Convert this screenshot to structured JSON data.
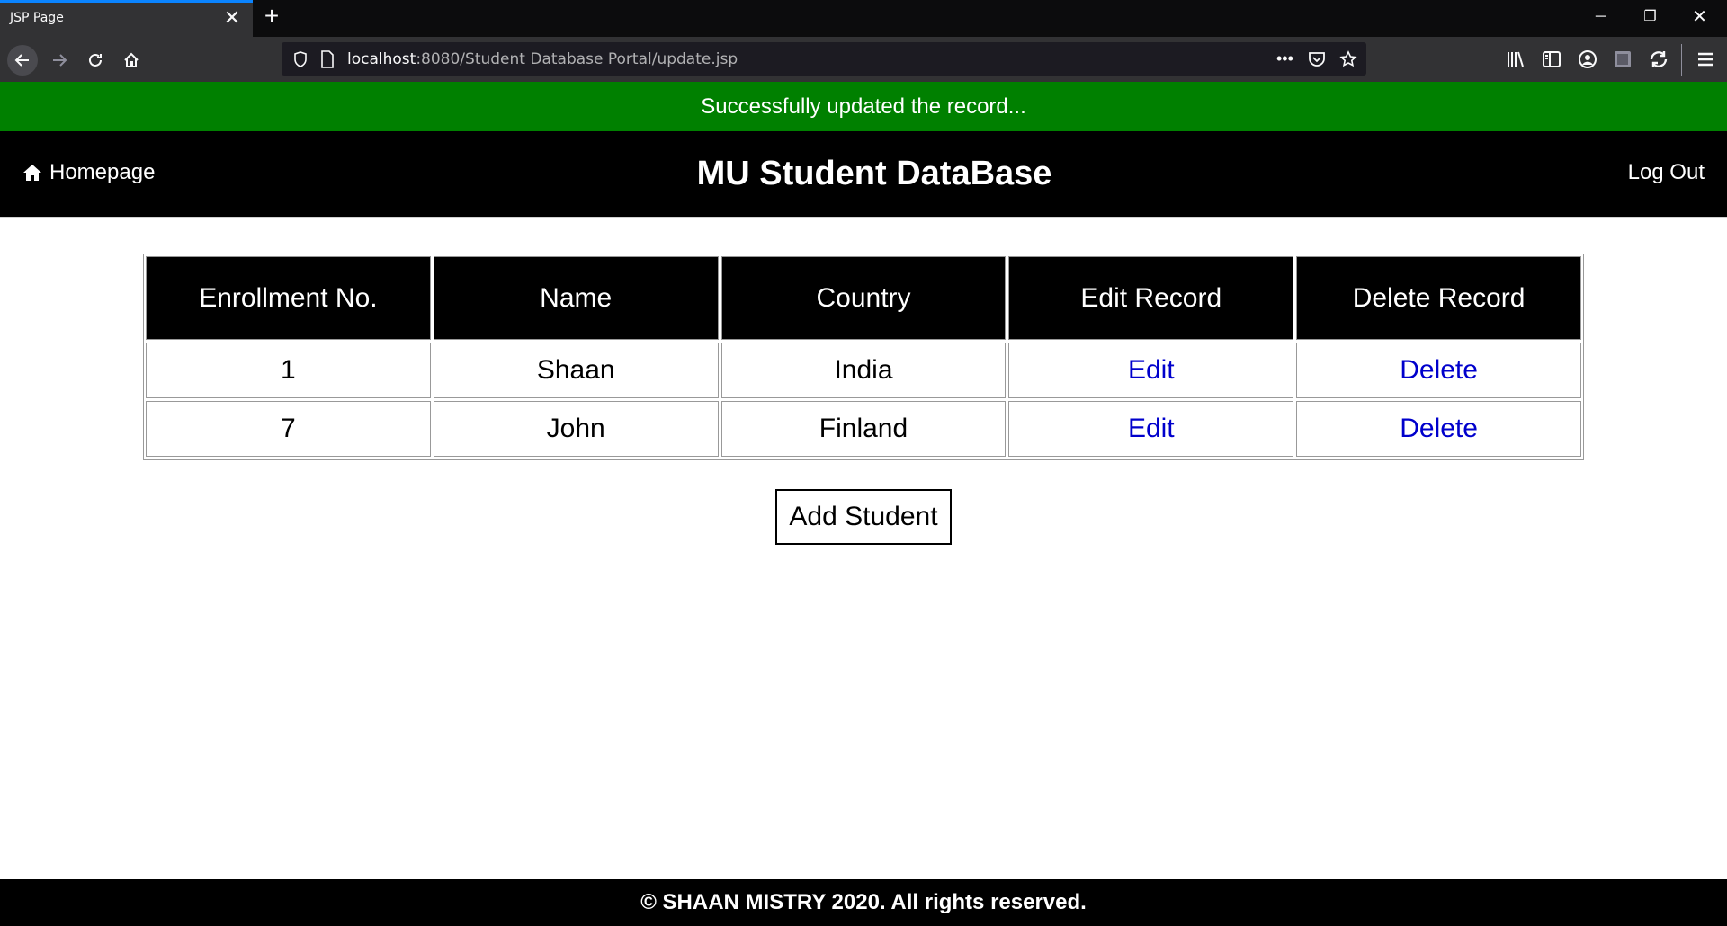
{
  "browser": {
    "tab_title": "JSP Page",
    "url_host": "localhost",
    "url_path": ":8080/Student Database Portal/update.jsp"
  },
  "flash": {
    "message": "Successfully updated the record...",
    "color": "#008000"
  },
  "header": {
    "home_label": "Homepage",
    "title": "MU Student DataBase",
    "logout_label": "Log Out"
  },
  "table": {
    "columns": [
      "Enrollment No.",
      "Name",
      "Country",
      "Edit Record",
      "Delete Record"
    ],
    "rows": [
      {
        "enrollment": "1",
        "name": "Shaan",
        "country": "India",
        "edit": "Edit",
        "delete": "Delete"
      },
      {
        "enrollment": "7",
        "name": "John",
        "country": "Finland",
        "edit": "Edit",
        "delete": "Delete"
      }
    ]
  },
  "add_button_label": "Add Student",
  "footer": {
    "text": "© SHAAN MISTRY 2020. All rights reserved."
  }
}
